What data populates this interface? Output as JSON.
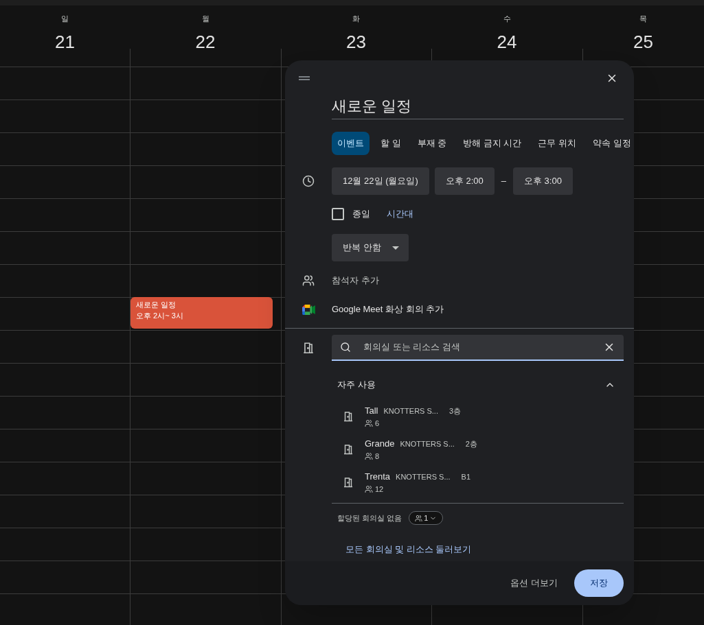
{
  "days": [
    {
      "weekday": "일",
      "date": "21"
    },
    {
      "weekday": "월",
      "date": "22",
      "events": [
        {
          "title": "새로운 일정",
          "time": "오후 2시~ 3시",
          "color": "#d9533a"
        }
      ]
    },
    {
      "weekday": "화",
      "date": "23"
    },
    {
      "weekday": "수",
      "date": "24"
    },
    {
      "weekday": "목",
      "date": "25"
    }
  ],
  "dialog": {
    "title": "새로운 일정",
    "tabs": [
      {
        "label": "이벤트",
        "selected": true
      },
      {
        "label": "할 일",
        "selected": false
      },
      {
        "label": "부재 중",
        "selected": false
      },
      {
        "label": "방해 금지 시간",
        "selected": false
      },
      {
        "label": "근무 위치",
        "selected": false
      },
      {
        "label": "약속 일정",
        "selected": false
      }
    ],
    "date": "12월 22일 (월요일)",
    "start": "오후 2:00",
    "separator": "–",
    "end": "오후 3:00",
    "all_day": {
      "label": "종일",
      "checked": false
    },
    "timezone": "시간대",
    "repeat": "반복 안함",
    "add_guests": "참석자 추가",
    "meet": "Google Meet 화상 회의 추가",
    "room_search": {
      "placeholder": "회의실 또는 리소스 검색"
    },
    "frequent": {
      "title": "자주 사용",
      "expanded": true,
      "rooms": [
        {
          "name": "Tall",
          "building": "KNOTTERS S...",
          "floor": "3층",
          "capacity": "6"
        },
        {
          "name": "Grande",
          "building": "KNOTTERS S...",
          "floor": "2층",
          "capacity": "8"
        },
        {
          "name": "Trenta",
          "building": "KNOTTERS S...",
          "floor": "B1",
          "capacity": "12"
        }
      ]
    },
    "no_room": "할당된 회의실 없음",
    "guest_count": "1",
    "browse_link": "모든 회의실 및 리소스 둘러보기",
    "more_options": "옵션 더보기",
    "save": "저장"
  }
}
